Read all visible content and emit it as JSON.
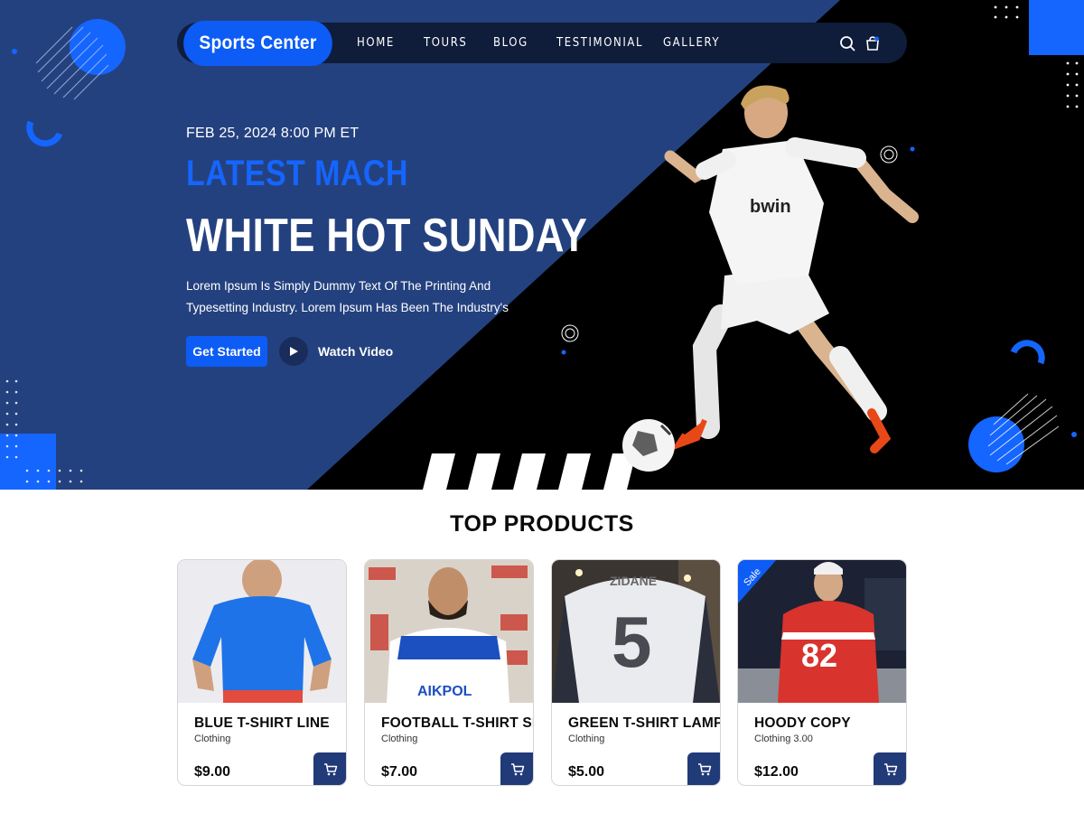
{
  "nav": {
    "logo": "Sports Center",
    "items": [
      "HOME",
      "TOURS",
      "BLOG",
      "TESTIMONIAL",
      "GALLERY"
    ]
  },
  "hero": {
    "date": "FEB 25, 2024 8:00 PM ET",
    "eyebrow": "LATEST MACH",
    "headline": "WHITE HOT SUNDAY",
    "description": "Lorem Ipsum Is Simply Dummy Text Of The Printing And Typesetting Industry. Lorem Ipsum Has Been The Industry's",
    "cta_primary": "Get Started",
    "cta_secondary": "Watch Video"
  },
  "products": {
    "title": "TOP PRODUCTS",
    "items": [
      {
        "name": "BLUE T-SHIRT LINE",
        "category": "Clothing",
        "price": "$9.00"
      },
      {
        "name": "FOOTBALL T-SHIRT SPAIN",
        "category": "Clothing",
        "price": "$7.00"
      },
      {
        "name": "GREEN T-SHIRT LAMP",
        "category": "Clothing",
        "price": "$5.00"
      },
      {
        "name": "HOODY COPY",
        "category": "Clothing 3.00",
        "price": "$12.00",
        "badge": "Sale"
      }
    ]
  },
  "colors": {
    "primary": "#0d5cf5",
    "hero_blue": "#24417f",
    "nav_dark": "#0f1c3a",
    "cart": "#213a78"
  },
  "icons": [
    "search-icon",
    "cart-icon",
    "play-icon"
  ]
}
